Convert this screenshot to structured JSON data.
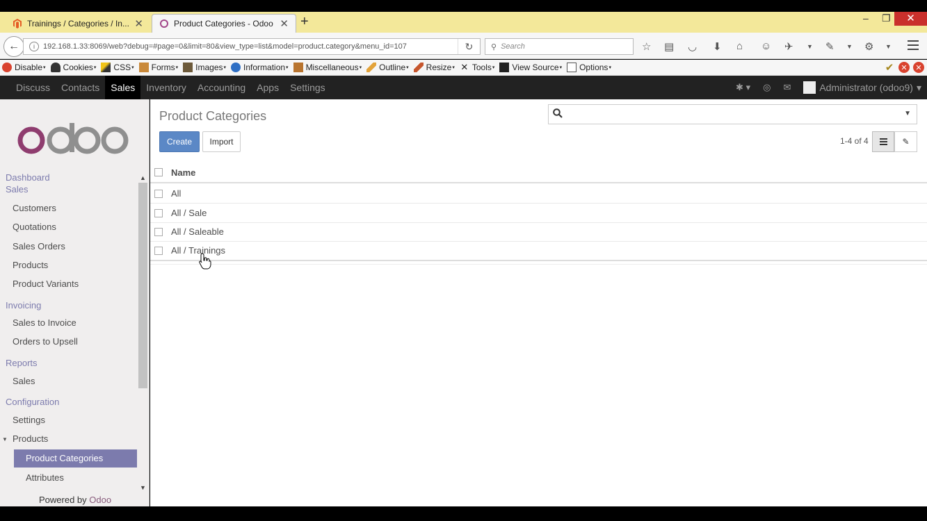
{
  "browser": {
    "tabs": [
      {
        "title": "Trainings / Categories / In...",
        "active": false
      },
      {
        "title": "Product Categories - Odoo",
        "active": true
      }
    ],
    "new_tab": "+",
    "url": "192.168.1.33:8069/web?debug=#page=0&limit=80&view_type=list&model=product.category&menu_id=107",
    "search_placeholder": "Search",
    "window_controls": {
      "minimize": "–",
      "restore": "❐",
      "close": "✕"
    }
  },
  "devbar": {
    "items": [
      "Disable",
      "Cookies",
      "CSS",
      "Forms",
      "Images",
      "Information",
      "Miscellaneous",
      "Outline",
      "Resize",
      "Tools",
      "View Source",
      "Options"
    ]
  },
  "odoo": {
    "top_menu": [
      "Discuss",
      "Contacts",
      "Sales",
      "Inventory",
      "Accounting",
      "Apps",
      "Settings"
    ],
    "active_menu": "Sales",
    "user": "Administrator (odoo9)",
    "user_caret": "▾",
    "bug_caret": "▾"
  },
  "sidebar": {
    "logo": "odoo",
    "sections": [
      {
        "label": "Dashboard"
      },
      {
        "label": "Sales"
      }
    ],
    "sales_items": [
      "Customers",
      "Quotations",
      "Sales Orders",
      "Products",
      "Product Variants"
    ],
    "invoicing": {
      "label": "Invoicing",
      "items": [
        "Sales to Invoice",
        "Orders to Upsell"
      ]
    },
    "reports": {
      "label": "Reports",
      "items": [
        "Sales"
      ]
    },
    "configuration": {
      "label": "Configuration",
      "items": [
        "Settings",
        "Products"
      ],
      "sub_items": [
        "Product Categories",
        "Attributes"
      ]
    },
    "selected": "Product Categories",
    "powered_prefix": "Powered by ",
    "powered_brand": "Odoo"
  },
  "main": {
    "title": "Product Categories",
    "create_label": "Create",
    "import_label": "Import",
    "pager": "1-4 of 4",
    "column_name": "Name",
    "rows": [
      "All",
      "All / Sale",
      "All / Saleable",
      "All / Trainings"
    ]
  },
  "colors": {
    "odoo_purple": "#875a7b",
    "menu_accent": "#7c7bad",
    "primary_button": "#5b88c6",
    "topbar": "#222222"
  }
}
